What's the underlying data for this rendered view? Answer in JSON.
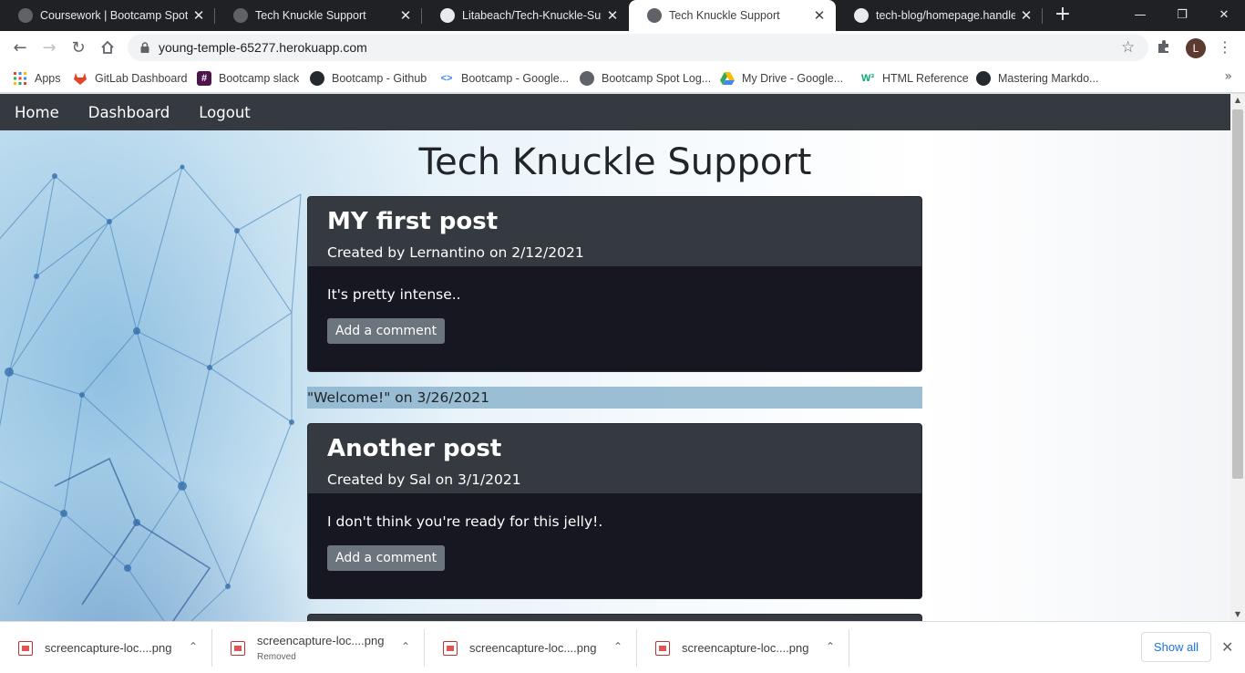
{
  "browser": {
    "tabs": [
      {
        "title": "Coursework | Bootcamp Spot",
        "icon": "bootcamp-spot-icon",
        "active": false
      },
      {
        "title": "Tech Knuckle Support",
        "icon": "globe-icon",
        "active": false
      },
      {
        "title": "Litabeach/Tech-Knuckle-Suppo",
        "icon": "github-icon",
        "active": false
      },
      {
        "title": "Tech Knuckle Support",
        "icon": "globe-icon",
        "active": true
      },
      {
        "title": "tech-blog/homepage.handleba",
        "icon": "github-icon",
        "active": false
      }
    ],
    "url": "young-temple-65277.herokuapp.com",
    "profile_initial": "L",
    "bookmarks": [
      {
        "label": "Apps",
        "icon": "apps-grid-icon"
      },
      {
        "label": "GitLab Dashboard",
        "icon": "gitlab-icon"
      },
      {
        "label": "Bootcamp slack",
        "icon": "slack-icon"
      },
      {
        "label": "Bootcamp - Github",
        "icon": "github-icon"
      },
      {
        "label": "Bootcamp - Google...",
        "icon": "google-code-icon"
      },
      {
        "label": "Bootcamp Spot Log...",
        "icon": "bootcamp-spot-icon"
      },
      {
        "label": "My Drive - Google...",
        "icon": "google-drive-icon"
      },
      {
        "label": "HTML Reference",
        "icon": "w3-icon"
      },
      {
        "label": "Mastering Markdo...",
        "icon": "github-icon"
      }
    ]
  },
  "site": {
    "nav": [
      "Home",
      "Dashboard",
      "Logout"
    ],
    "title": "Tech Knuckle Support",
    "posts": [
      {
        "title": "MY first post",
        "meta": "Created by Lernantino on 2/12/2021",
        "body": "It's pretty intense..",
        "button": "Add a comment"
      },
      {
        "title": "Another post",
        "meta": "Created by Sal on 3/1/2021",
        "body": "I don't think you're ready for this jelly!.",
        "button": "Add a comment"
      }
    ],
    "comments": [
      {
        "text": "\"Welcome!\" on 3/26/2021"
      }
    ]
  },
  "downloads": {
    "items": [
      {
        "name": "screencapture-loc....png",
        "status": ""
      },
      {
        "name": "screencapture-loc....png",
        "status": "Removed"
      },
      {
        "name": "screencapture-loc....png",
        "status": ""
      },
      {
        "name": "screencapture-loc....png",
        "status": ""
      }
    ],
    "show_all": "Show all"
  },
  "colors": {
    "navbar": "#343a40",
    "card_body": "#171721",
    "button": "#6c757d",
    "comment_bg": "#8cb4cd"
  }
}
